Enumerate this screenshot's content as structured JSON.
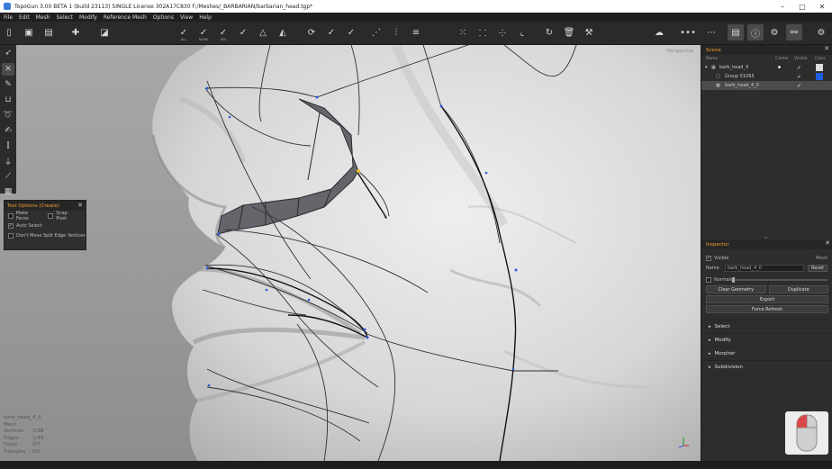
{
  "titlebar": {
    "title": "TopoGun 3.00 BETA 1 (build 23113)   SINGLE License   302A17C830   F:/Meshes/_BARBARIAN/barbarian_head.tgp*",
    "minimize": "–",
    "maximize": "□",
    "close": "✕"
  },
  "menu": [
    "File",
    "Edit",
    "Mesh",
    "Select",
    "Modify",
    "Reference Mesh",
    "Options",
    "View",
    "Help"
  ],
  "toolbar": {
    "sub_labels": [
      "ALL",
      "NONE",
      "INV",
      "",
      "",
      "",
      "",
      "",
      ""
    ]
  },
  "tool_options": {
    "title": "Tool Options (Create)",
    "close": "✕",
    "options": [
      {
        "label": "Make Faces",
        "checked": false
      },
      {
        "label": "Snap Pixel",
        "checked": false
      },
      {
        "label": "Auto Select",
        "checked": true
      },
      {
        "label": "Don't Move Split Edge Vertices",
        "checked": false
      }
    ]
  },
  "viewport": {
    "label": "Perspective"
  },
  "stats": {
    "object_name": "barb_head_4_0",
    "type": "Mesh",
    "rows": [
      {
        "k": "Vertices :",
        "v": "1/38"
      },
      {
        "k": "Edges :",
        "v": "1/49"
      },
      {
        "k": "Faces :",
        "v": "0/7"
      },
      {
        "k": "Triangles :",
        "v": "0/0"
      }
    ]
  },
  "scene": {
    "title": "Scene",
    "close": "✕",
    "columns": {
      "name": "Name",
      "center": "Center",
      "visible": "Visible",
      "color": "Color"
    },
    "items": [
      {
        "name": "barb_head_4",
        "indent": 0,
        "center": true,
        "visible": true,
        "color": "#dddddd",
        "selected": false
      },
      {
        "name": "Group 51065",
        "indent": 1,
        "center": false,
        "visible": true,
        "color": "#1f5fe0",
        "selected": false
      },
      {
        "name": "barb_head_4_0",
        "indent": 1,
        "center": false,
        "visible": true,
        "color": "",
        "selected": true
      }
    ]
  },
  "inspector": {
    "title": "Inspector",
    "close": "✕",
    "visible_label": "Visible",
    "type_label": "Mesh",
    "name_label": "Name",
    "name_value": "barb_head_4_0",
    "reset_label": "Reset",
    "normals_label": "Normals",
    "clear_geometry": "Clear Geometry",
    "duplicate": "Duplicate",
    "export": "Export",
    "force_refresh": "Force Refresh",
    "sections": [
      "Select",
      "Modify",
      "Morpher",
      "Subdivision"
    ]
  },
  "colors": {
    "accent": "#f0a030",
    "panel_bg": "#2d2d2d",
    "viewport_bg": "#d9d9d9",
    "topology_fill": "#5a5a62"
  }
}
